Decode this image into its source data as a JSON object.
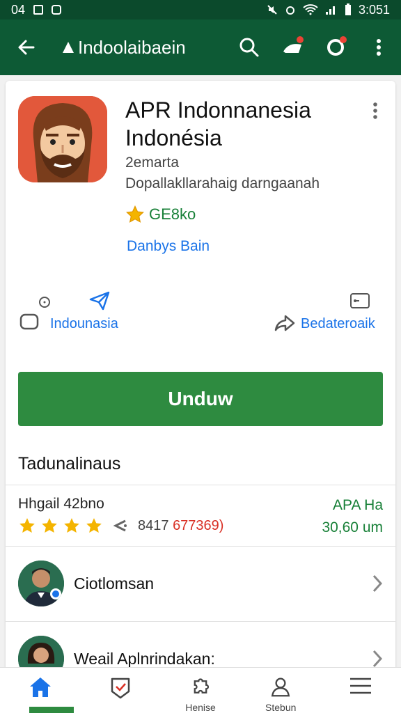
{
  "status_bar": {
    "left_text": "04",
    "time": "3:051"
  },
  "app_bar": {
    "title": "Indoolaibaein"
  },
  "app": {
    "name": "APR Indonnanesia Indonésia",
    "developer": "2emarta",
    "description": "Dopallakllarahaig darngaanah",
    "rating_text": "GE8ko",
    "category_link": "Danbys Bain"
  },
  "meta": {
    "left_label": "Indounasia",
    "right_label": "Bedateroaik"
  },
  "install_button": {
    "label": "Unduw"
  },
  "reviews": {
    "section_title": "Tadunalinaus",
    "label": "Hhgail 42bno",
    "stars": 4,
    "count_main": "8417",
    "count_red": "677369)",
    "ads_label": "APA Ha",
    "ads_value": "30,60 um"
  },
  "list": [
    {
      "label": "Ciotlomsan"
    },
    {
      "label": "Weail Aplnrindakan:"
    }
  ],
  "bottom_nav": [
    {
      "icon": "home-icon",
      "label": ""
    },
    {
      "icon": "check-badge-icon",
      "label": ""
    },
    {
      "icon": "puzzle-icon",
      "label": "Henise"
    },
    {
      "icon": "person-icon",
      "label": "Stebun"
    },
    {
      "icon": "menu-icon",
      "label": ""
    }
  ],
  "colors": {
    "status_bar": "#0b4a2c",
    "app_bar": "#0d5a35",
    "install": "#2e8b40",
    "link": "#1a73e8",
    "rating_green": "#188038",
    "star": "#f4b400"
  }
}
